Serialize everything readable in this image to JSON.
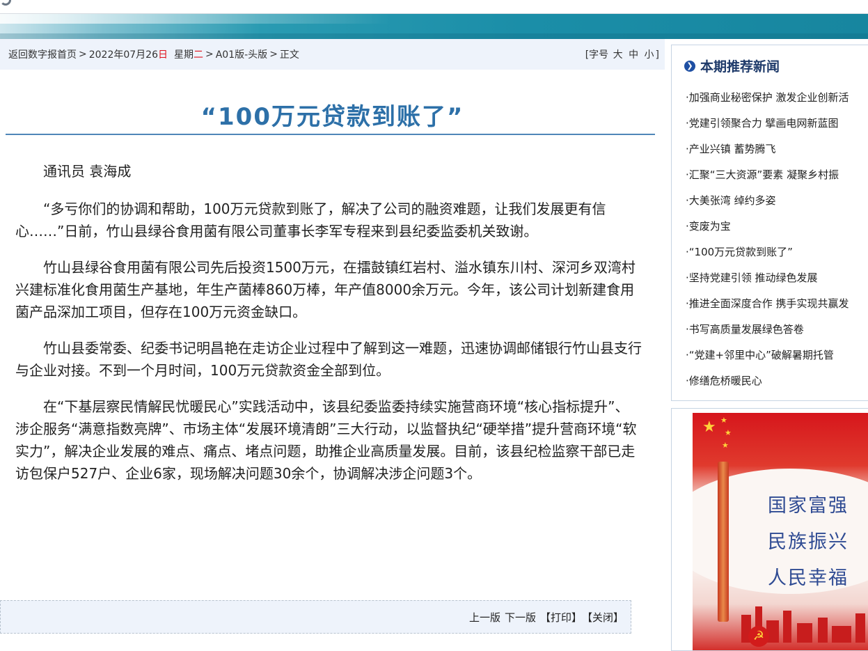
{
  "breadcrumb": {
    "home": "返回数字报首页",
    "sep": ">",
    "date_prefix": "2022年07月26",
    "date_day_char": "日",
    "weekday_prefix": "星期",
    "weekday_char": "二",
    "edition": "A01版-头版",
    "current": "正文"
  },
  "font_size_control": {
    "open": "[字号",
    "large": "大",
    "medium": "中",
    "small": "小",
    "close": "]"
  },
  "article": {
    "title": "“100万元贷款到账了”",
    "author": "通讯员 袁海成",
    "paragraphs": [
      "“多亏你们的协调和帮助，100万元贷款到账了，解决了公司的融资难题，让我们发展更有信心……”日前，竹山县绿谷食用菌有限公司董事长李军专程来到县纪委监委机关致谢。",
      "竹山县绿谷食用菌有限公司先后投资1500万元，在擂鼓镇红岩村、溢水镇东川村、深河乡双湾村兴建标准化食用菌生产基地，年生产菌棒860万棒，年产值8000余万元。今年，该公司计划新建食用菌产品深加工项目，但存在100万元资金缺口。",
      "竹山县委常委、纪委书记明昌艳在走访企业过程中了解到这一难题，迅速协调邮储银行竹山县支行与企业对接。不到一个月时间，100万元贷款资金全部到位。",
      "在“下基层察民情解民忧暖民心”实践活动中，该县纪委监委持续实施营商环境“核心指标提升”、涉企服务“满意指数亮牌”、市场主体“发展环境清朗”三大行动，以监督执纪“硬举措”提升营商环境“软实力”，解决企业发展的难点、痛点、堵点问题，助推企业高质量发展。目前，该县纪检监察干部已走访包保户527户、企业6家，现场解决问题30余个，协调解决涉企问题3个。"
    ]
  },
  "footer_nav": {
    "prev": "上一版",
    "next": "下一版",
    "print": "【打印】",
    "close": "【关闭】"
  },
  "sidebar": {
    "heading": "本期推荐新闻",
    "heading_icon": "chevron-circle-right-icon",
    "items": [
      "·加强商业秘密保护 激发企业创新活",
      "·党建引领聚合力 擘画电网新蓝图",
      "·产业兴镇 蓄势腾飞",
      "·汇聚“三大资源”要素 凝聚乡村振",
      "·大美张湾 绰约多姿",
      "·变废为宝",
      "·“100万元贷款到账了”",
      "·坚持党建引领 推动绿色发展",
      "·推进全面深度合作 携手实现共赢发",
      "·书写高质量发展绿色答卷",
      "·“党建+邻里中心”破解暑期托管",
      "·修缮危桥暖民心"
    ]
  },
  "promo": {
    "lines": [
      "国家富强",
      "民族振兴",
      "人民幸福"
    ]
  },
  "colors": {
    "title": "#2d70a8",
    "accent_red": "#e0121c",
    "banner": "#1b8ea8",
    "crumb_bg": "#eef3fb"
  }
}
